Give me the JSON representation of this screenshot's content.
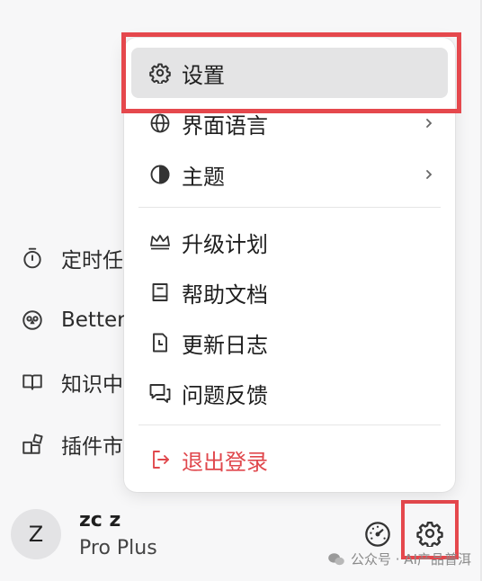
{
  "sidebar": {
    "items": [
      {
        "label": "定时任",
        "icon": "timer-icon"
      },
      {
        "label": "Better",
        "icon": "owl-icon"
      },
      {
        "label": "知识中",
        "icon": "book-icon"
      },
      {
        "label": "插件市",
        "icon": "plugin-icon"
      }
    ]
  },
  "user": {
    "avatar_initial": "Z",
    "name": "zc z",
    "plan": "Pro Plus"
  },
  "menu": {
    "items": [
      {
        "label": "设置",
        "icon": "gear-icon",
        "active": true
      },
      {
        "label": "界面语言",
        "icon": "globe-icon",
        "submenu": true
      },
      {
        "label": "主题",
        "icon": "theme-icon",
        "submenu": true
      },
      {
        "label": "升级计划",
        "icon": "crown-icon"
      },
      {
        "label": "帮助文档",
        "icon": "book-icon"
      },
      {
        "label": "更新日志",
        "icon": "changelog-icon"
      },
      {
        "label": "问题反馈",
        "icon": "feedback-icon"
      },
      {
        "label": "退出登录",
        "icon": "logout-icon",
        "danger": true
      }
    ]
  },
  "watermark": {
    "text": "公众号 · AI产品普洱"
  },
  "colors": {
    "highlight": "#e5484d",
    "danger": "#e0474c",
    "active_bg": "#e4e4e5"
  }
}
